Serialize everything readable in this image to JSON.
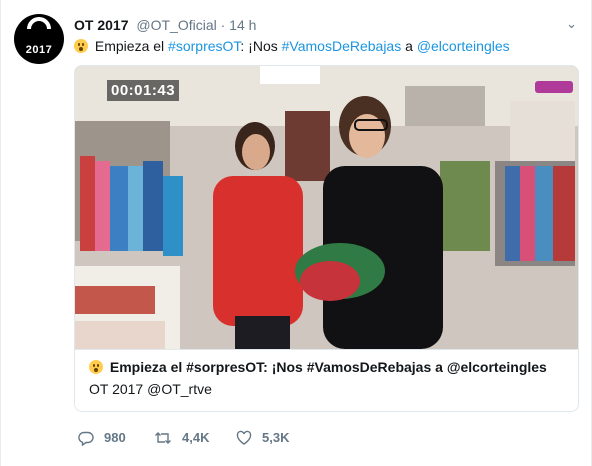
{
  "account": {
    "avatar_text": "2017",
    "name": "OT 2017",
    "handle": "@OT_Oficial",
    "separator": "·",
    "time": "14 h"
  },
  "tweet": {
    "emoji_icon": "astonished-face-icon",
    "text_plain_1": " Empieza el ",
    "hashtag_1": "#sorpresOT",
    "text_plain_2": ": ¡Nos ",
    "hashtag_2": "#VamosDeRebajas",
    "text_plain_3": " a ",
    "mention": "@elcorteingles",
    "link_color": "#1b95e0"
  },
  "card": {
    "video_timer": "00:01:43",
    "title": " Empieza el #sorpresOT: ¡Nos #VamosDeRebajas a @elcorteingles",
    "subtitle": "OT 2017 @OT_rtve"
  },
  "actions": {
    "reply_count": "980",
    "retweet_count": "4,4K",
    "like_count": "5,3K"
  }
}
